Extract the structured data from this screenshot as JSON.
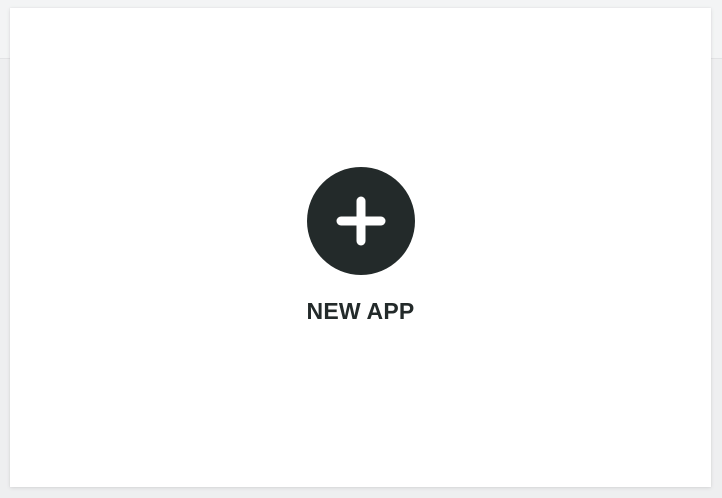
{
  "new_app": {
    "label": "NEW APP",
    "icon": "plus-icon"
  },
  "colors": {
    "background": "#eeeff0",
    "card": "#ffffff",
    "accent_dark": "#232a2a",
    "icon_glyph": "#ffffff"
  }
}
